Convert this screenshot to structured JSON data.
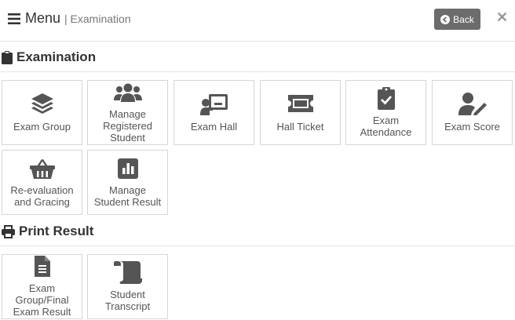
{
  "header": {
    "menu_label": "Menu",
    "breadcrumb": "| Examination",
    "back_label": "Back"
  },
  "sections": [
    {
      "title": "Examination",
      "icon": "clipboard-icon"
    },
    {
      "title": "Print Result",
      "icon": "print-icon"
    }
  ],
  "tiles": {
    "exam_group": "Exam Group",
    "manage_registered_student": [
      "Manage",
      "Registered",
      "Student"
    ],
    "exam_hall": "Exam Hall",
    "hall_ticket": "Hall Ticket",
    "exam_attendance": [
      "Exam",
      "Attendance"
    ],
    "exam_score": "Exam Score",
    "reevaluation": [
      "Re-evaluation",
      "and Gracing"
    ],
    "manage_student_result": [
      "Manage",
      "Student Result"
    ],
    "exam_group_final_result": [
      "Exam",
      "Group/Final",
      "Exam Result"
    ],
    "student_transcript": [
      "Student",
      "Transcript"
    ]
  },
  "colors": {
    "icon": "#555555",
    "back_button": "#6c6c6c"
  }
}
